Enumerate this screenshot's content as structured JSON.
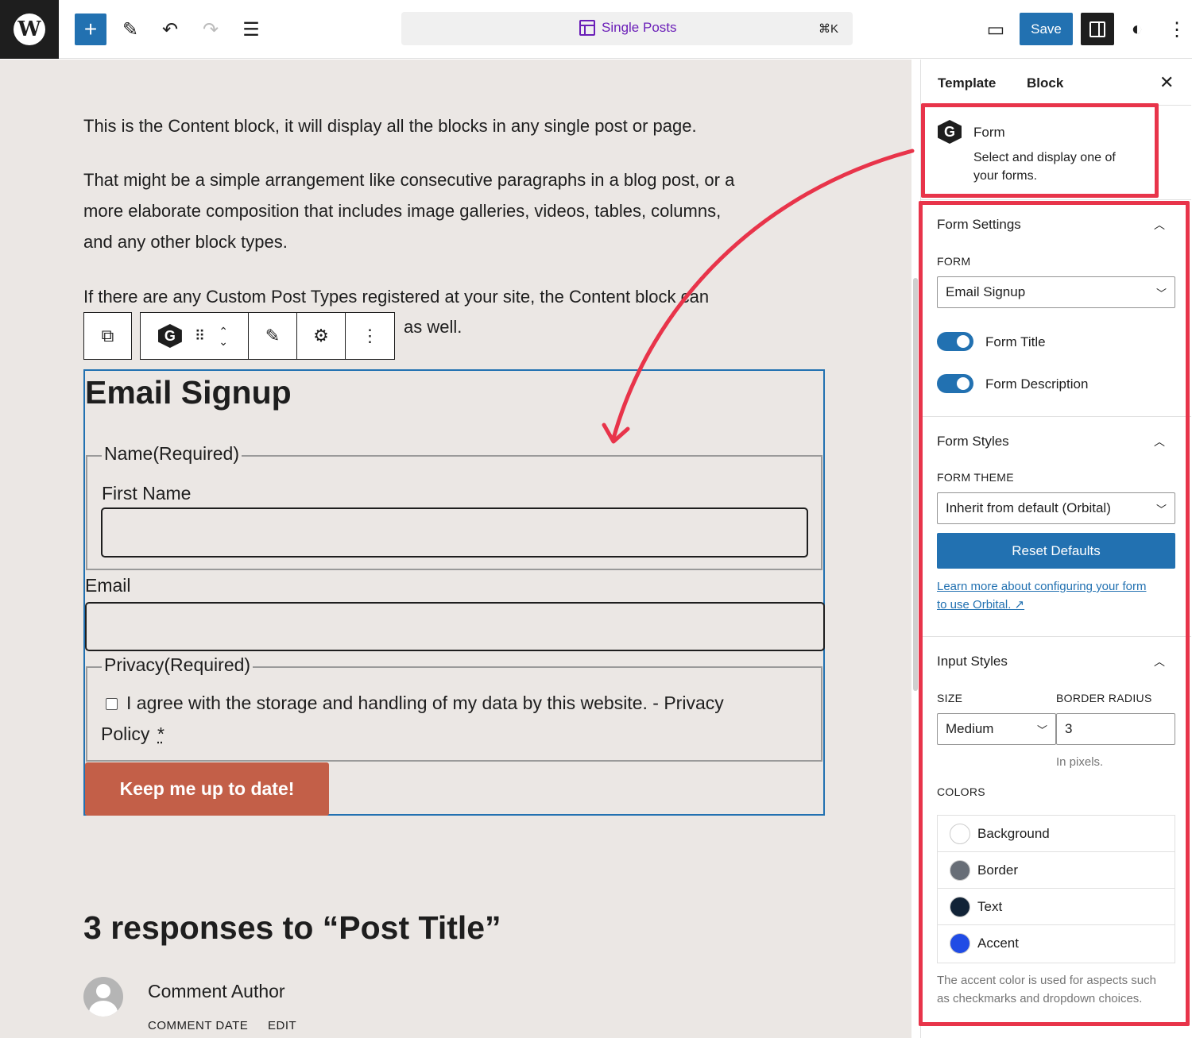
{
  "topbar": {
    "logo_label": "W",
    "add_icon": "+",
    "edit_icon": "✎",
    "undo_icon": "↶",
    "redo_icon": "↷",
    "list_view_icon": "☰",
    "template_title": "Single Posts",
    "shortcut": "⌘K",
    "view_icon": "▭",
    "save_label": "Save",
    "styles_icon": "◐",
    "options_icon": "⋮"
  },
  "content": {
    "paragraph_1": "This is the Content block, it will display all the blocks in any single post or page.",
    "paragraph_2_line_1": "That might be a simple arrangement like consecutive paragraphs in a blog post, or a",
    "paragraph_2_line_2": "more elaborate composition that includes image galleries, videos, tables, columns,",
    "paragraph_2_line_3": "and any other block types.",
    "paragraph_3_line_1": "If there are any Custom Post Types registered at your site, the Content block can",
    "paragraph_3_line_2_tail": "as well."
  },
  "block_toolbar": {
    "parent_icon": "⧉",
    "block_icon": "G",
    "drag_icon": "⠿",
    "move_icon": "⌃⌄",
    "edit_icon": "✎",
    "settings_icon": "⚙",
    "more_icon": "⋮"
  },
  "form": {
    "heading": "Email Signup",
    "name_legend": "Name(Required)",
    "first_name_label": "First Name",
    "email_label": "Email",
    "privacy_legend": "Privacy(Required)",
    "consent_line_1": "I agree with the storage and handling of my data by this website. - Privacy",
    "consent_line_2": "Policy",
    "consent_required": "*",
    "submit_label": "Keep me up to date!"
  },
  "comments": {
    "heading": "3 responses to “Post Title”",
    "author": "Comment Author",
    "date": "COMMENT DATE",
    "edit": "EDIT"
  },
  "sidebar": {
    "tab_template": "Template",
    "tab_block": "Block",
    "close_icon": "✕",
    "block_card": {
      "icon_letter": "G",
      "title": "Form",
      "description_line_1": "Select and display one of",
      "description_line_2": "your forms."
    },
    "form_settings": {
      "title": "Form Settings",
      "form_caption": "FORM",
      "form_value": "Email Signup",
      "toggle_title_label": "Form Title",
      "toggle_title_on": true,
      "toggle_description_label": "Form Description",
      "toggle_description_on": true
    },
    "form_styles": {
      "title": "Form Styles",
      "theme_caption": "FORM THEME",
      "theme_value": "Inherit from default (Orbital)",
      "reset_label": "Reset Defaults",
      "link_line_1": "Learn more about configuring your form",
      "link_line_2": "to use Orbital. ↗"
    },
    "input_styles": {
      "title": "Input Styles",
      "size_caption": "SIZE",
      "size_value": "Medium",
      "radius_caption": "BORDER RADIUS",
      "radius_value": "3",
      "radius_help": "In pixels.",
      "colors_caption": "COLORS",
      "colors": [
        {
          "name": "Background",
          "color": "#ffffff"
        },
        {
          "name": "Border",
          "color": "#686e77"
        },
        {
          "name": "Text",
          "color": "#112337"
        },
        {
          "name": "Accent",
          "color": "#204ce5"
        }
      ],
      "colors_help_line_1": "The accent color is used for aspects such",
      "colors_help_line_2": "as checkmarks and dropdown choices."
    }
  },
  "colors": {
    "accent": "#2271b1",
    "highlight": "#e8344a",
    "submit": "#c35f48",
    "template_title": "#6b1fb8"
  }
}
